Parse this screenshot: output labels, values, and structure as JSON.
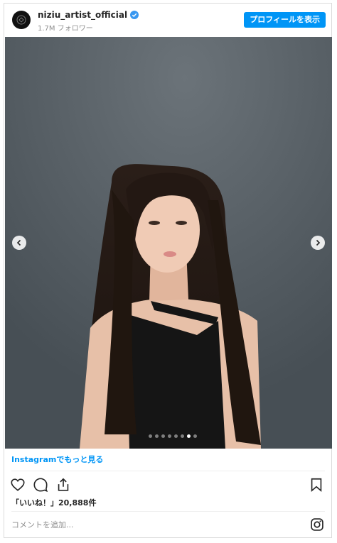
{
  "header": {
    "username": "niziu_artist_official",
    "followers": "1.7M フォロワー",
    "profile_button": "プロフィールを表示"
  },
  "carousel": {
    "total_slides": 8,
    "active_slide": 7
  },
  "footer": {
    "more_link": "Instagramでもっと見る",
    "likes_label": "「いいね！」20,888件",
    "comment_placeholder": "コメントを追加..."
  },
  "colors": {
    "accent": "#0095f6",
    "verified": "#3897f0",
    "text": "#262626",
    "muted": "#8e8e8e"
  }
}
